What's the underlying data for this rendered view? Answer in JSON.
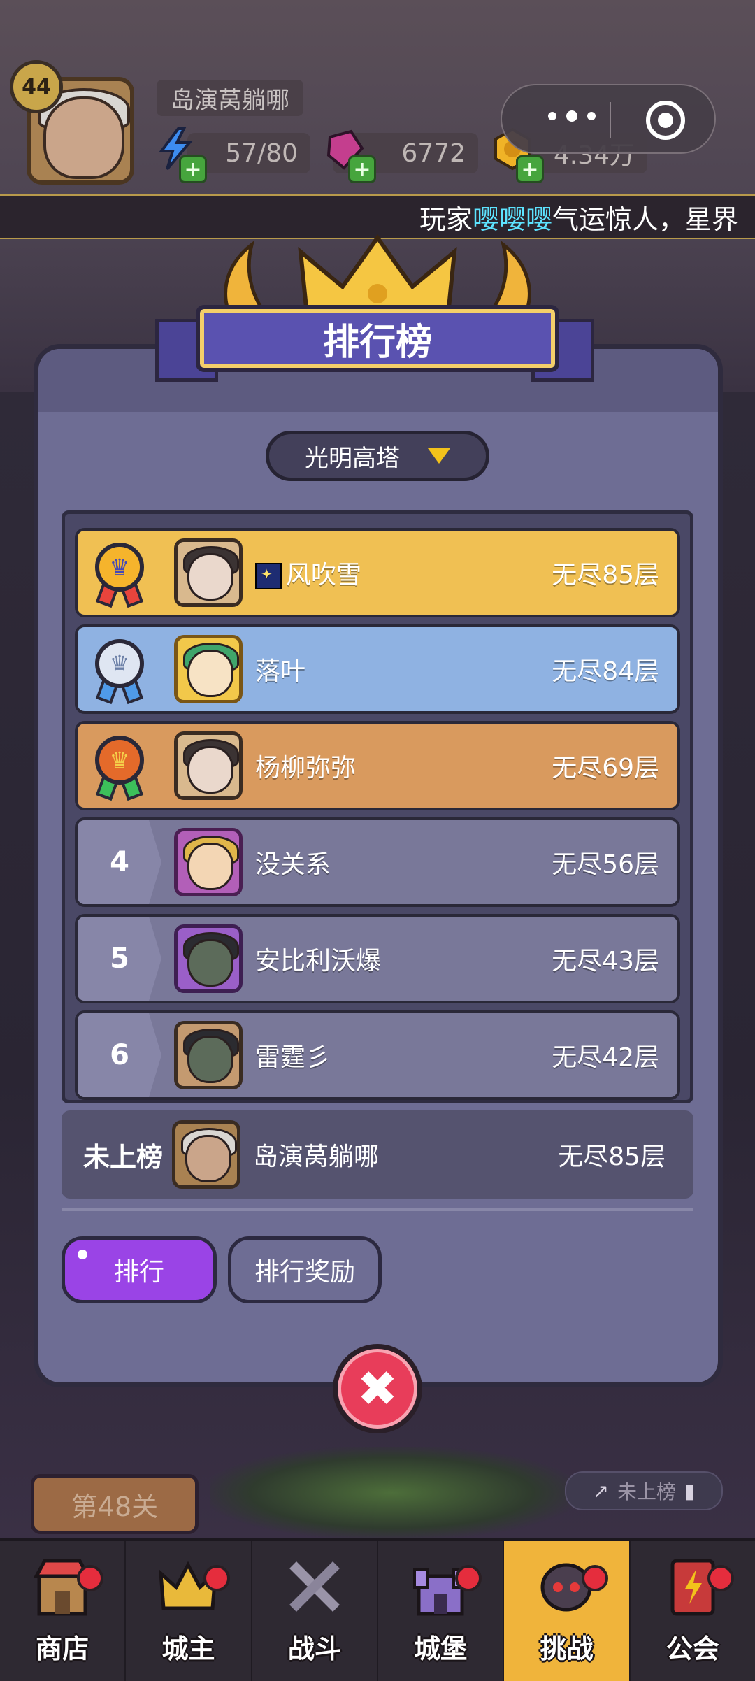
{
  "header": {
    "level": "44",
    "player_name": "岛演莴躺哪",
    "energy": "57/80",
    "gems": "6772",
    "coins": "4.34万",
    "marquee_prefix": "玩家",
    "marquee_player": "嘤嘤嘤",
    "marquee_suffix": "气运惊人，星界"
  },
  "panel": {
    "title": "排行榜",
    "dropdown_selected": "光明高塔",
    "rows": [
      {
        "rank": "1",
        "name": "风吹雪",
        "score": "无尽85层",
        "style": "gold"
      },
      {
        "rank": "2",
        "name": "落叶",
        "score": "无尽84层",
        "style": "silver"
      },
      {
        "rank": "3",
        "name": "杨柳弥弥",
        "score": "无尽69层",
        "style": "bronze"
      },
      {
        "rank": "4",
        "name": "没关系",
        "score": "无尽56层",
        "style": "plain"
      },
      {
        "rank": "5",
        "name": "安比利沃爆",
        "score": "无尽43层",
        "style": "plain"
      },
      {
        "rank": "6",
        "name": "雷霆彡",
        "score": "无尽42层",
        "style": "plain"
      }
    ],
    "self": {
      "rank": "未上榜",
      "name": "岛演莴躺哪",
      "score": "无尽85层"
    },
    "tabs": {
      "ranking": "排行",
      "rewards": "排行奖励"
    }
  },
  "stage": {
    "label": "第48关",
    "rank_status": "未上榜"
  },
  "nav": [
    {
      "label": "商店",
      "icon": "shop-icon",
      "badge": true
    },
    {
      "label": "城主",
      "icon": "crown-icon",
      "badge": true
    },
    {
      "label": "战斗",
      "icon": "swords-icon",
      "badge": false
    },
    {
      "label": "城堡",
      "icon": "castle-icon",
      "badge": true
    },
    {
      "label": "挑战",
      "icon": "skull-icon",
      "badge": true,
      "active": true
    },
    {
      "label": "公会",
      "icon": "banner-icon",
      "badge": true
    }
  ],
  "colors": {
    "gold_row": "#f0c053",
    "silver_row": "#8fb2e2",
    "bronze_row": "#d99a5e",
    "active_tab": "#9a44e6",
    "close": "#e83d5a",
    "marquee_highlight": "#5de3ff"
  }
}
